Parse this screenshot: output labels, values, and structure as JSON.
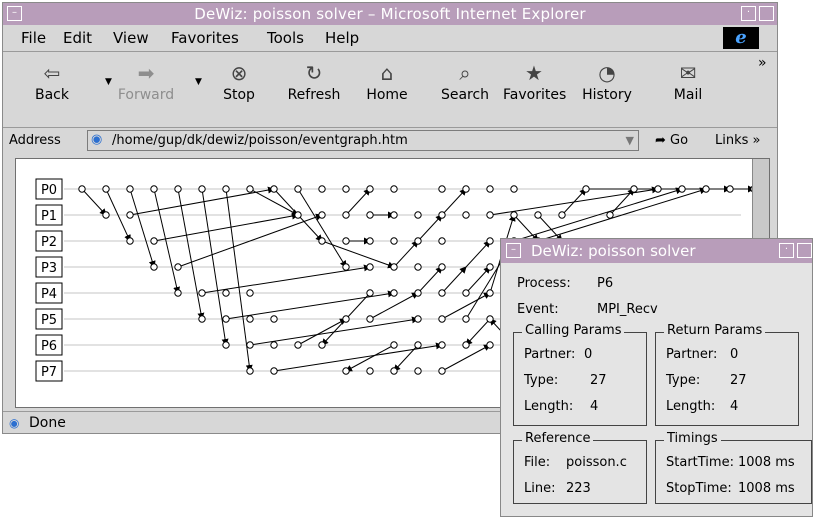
{
  "window": {
    "title": "DeWiz: poisson solver – Microsoft Internet Explorer"
  },
  "menu": {
    "items": [
      {
        "label": "File",
        "accel": "F"
      },
      {
        "label": "Edit",
        "accel": "E"
      },
      {
        "label": "View",
        "accel": "V"
      },
      {
        "label": "Favorites",
        "accel": "a"
      },
      {
        "label": "Tools",
        "accel": "T"
      },
      {
        "label": "Help",
        "accel": "H"
      }
    ],
    "logo": "e"
  },
  "toolbar": {
    "buttons": [
      {
        "label": "Back",
        "icon": "back-arrow-icon",
        "glyph": "⇦",
        "enabled": true
      },
      {
        "label": "Forward",
        "icon": "forward-arrow-icon",
        "glyph": "➡",
        "enabled": false
      },
      {
        "label": "Stop",
        "icon": "stop-icon",
        "glyph": "⊗",
        "enabled": true
      },
      {
        "label": "Refresh",
        "icon": "refresh-icon",
        "glyph": "↻",
        "enabled": true
      },
      {
        "label": "Home",
        "icon": "home-icon",
        "glyph": "⌂",
        "enabled": true
      },
      {
        "label": "Search",
        "icon": "search-icon",
        "glyph": "⌕",
        "enabled": true
      },
      {
        "label": "Favorites",
        "icon": "favorites-icon",
        "glyph": "★",
        "enabled": true
      },
      {
        "label": "History",
        "icon": "history-icon",
        "glyph": "◔",
        "enabled": true
      },
      {
        "label": "Mail",
        "icon": "mail-icon",
        "glyph": "✉",
        "enabled": true
      }
    ],
    "overflow": "»"
  },
  "address": {
    "label": "Address",
    "url": "/home/gup/dk/dewiz/poisson/eventgraph.htm",
    "go_label": "Go",
    "links_label": "Links »"
  },
  "event_graph": {
    "processes": [
      "P0",
      "P1",
      "P2",
      "P3",
      "P4",
      "P5",
      "P6",
      "P7"
    ],
    "events": [
      [
        0,
        0
      ],
      [
        1,
        0
      ],
      [
        2,
        0
      ],
      [
        3,
        0
      ],
      [
        4,
        0
      ],
      [
        5,
        0
      ],
      [
        6,
        0
      ],
      [
        7,
        0
      ],
      [
        8,
        0
      ],
      [
        9,
        0
      ],
      [
        10,
        0
      ],
      [
        11,
        0
      ],
      [
        12,
        0
      ],
      [
        13,
        0
      ],
      [
        15,
        0
      ],
      [
        16,
        0
      ],
      [
        17,
        0
      ],
      [
        18,
        0
      ],
      [
        21,
        0
      ],
      [
        23,
        0
      ],
      [
        24,
        0
      ],
      [
        25,
        0
      ],
      [
        26,
        0
      ],
      [
        27,
        0
      ],
      [
        28,
        0
      ],
      [
        1,
        1
      ],
      [
        2,
        1
      ],
      [
        9,
        1
      ],
      [
        10,
        1
      ],
      [
        11,
        1
      ],
      [
        12,
        1
      ],
      [
        13,
        1
      ],
      [
        14,
        1
      ],
      [
        15,
        1
      ],
      [
        16,
        1
      ],
      [
        17,
        1
      ],
      [
        18,
        1
      ],
      [
        19,
        1
      ],
      [
        20,
        1
      ],
      [
        22,
        1
      ],
      [
        2,
        2
      ],
      [
        3,
        2
      ],
      [
        10,
        2
      ],
      [
        11,
        2
      ],
      [
        12,
        2
      ],
      [
        13,
        2
      ],
      [
        14,
        2
      ],
      [
        15,
        2
      ],
      [
        17,
        2
      ],
      [
        18,
        2
      ],
      [
        19,
        2
      ],
      [
        3,
        3
      ],
      [
        4,
        3
      ],
      [
        11,
        3
      ],
      [
        12,
        3
      ],
      [
        13,
        3
      ],
      [
        14,
        3
      ],
      [
        15,
        3
      ],
      [
        17,
        3
      ],
      [
        4,
        4
      ],
      [
        5,
        4
      ],
      [
        6,
        4
      ],
      [
        7,
        4
      ],
      [
        12,
        4
      ],
      [
        13,
        4
      ],
      [
        14,
        4
      ],
      [
        15,
        4
      ],
      [
        16,
        4
      ],
      [
        17,
        4
      ],
      [
        5,
        5
      ],
      [
        6,
        5
      ],
      [
        7,
        5
      ],
      [
        8,
        5
      ],
      [
        11,
        5
      ],
      [
        12,
        5
      ],
      [
        14,
        5
      ],
      [
        15,
        5
      ],
      [
        16,
        5
      ],
      [
        17,
        5
      ],
      [
        6,
        6
      ],
      [
        7,
        6
      ],
      [
        8,
        6
      ],
      [
        9,
        6
      ],
      [
        10,
        6
      ],
      [
        13,
        6
      ],
      [
        14,
        6
      ],
      [
        15,
        6
      ],
      [
        16,
        6
      ],
      [
        17,
        6
      ],
      [
        18,
        6
      ],
      [
        7,
        7
      ],
      [
        8,
        7
      ],
      [
        11,
        7
      ],
      [
        12,
        7
      ],
      [
        13,
        7
      ],
      [
        14,
        7
      ],
      [
        15,
        7
      ]
    ],
    "messages": [
      [
        0,
        0,
        1,
        1
      ],
      [
        1,
        0,
        2,
        2
      ],
      [
        2,
        0,
        3,
        3
      ],
      [
        3,
        0,
        4,
        4
      ],
      [
        4,
        0,
        5,
        5
      ],
      [
        5,
        0,
        6,
        6
      ],
      [
        6,
        0,
        7,
        7
      ],
      [
        2,
        1,
        8,
        0
      ],
      [
        3,
        2,
        9,
        1
      ],
      [
        4,
        3,
        10,
        1
      ],
      [
        7,
        0,
        9,
        1
      ],
      [
        8,
        0,
        10,
        2
      ],
      [
        9,
        0,
        11,
        3
      ],
      [
        5,
        4,
        12,
        3
      ],
      [
        6,
        5,
        13,
        4
      ],
      [
        7,
        6,
        14,
        5
      ],
      [
        8,
        7,
        15,
        6
      ],
      [
        9,
        6,
        11,
        5
      ],
      [
        10,
        2,
        13,
        3
      ],
      [
        11,
        2,
        12,
        2
      ],
      [
        12,
        4,
        10,
        6
      ],
      [
        13,
        3,
        14,
        2
      ],
      [
        14,
        2,
        15,
        1
      ],
      [
        15,
        1,
        16,
        0
      ],
      [
        16,
        3,
        17,
        2
      ],
      [
        17,
        5,
        16,
        6
      ],
      [
        11,
        1,
        12,
        0
      ],
      [
        12,
        1,
        13,
        1
      ],
      [
        13,
        6,
        11,
        7
      ],
      [
        14,
        6,
        13,
        7
      ],
      [
        15,
        4,
        16,
        3
      ],
      [
        16,
        4,
        17,
        3
      ],
      [
        17,
        4,
        18,
        1
      ],
      [
        18,
        1,
        19,
        2
      ],
      [
        19,
        1,
        20,
        2
      ],
      [
        20,
        1,
        21,
        0
      ],
      [
        22,
        1,
        23,
        0
      ],
      [
        14,
        4,
        15,
        3
      ],
      [
        15,
        5,
        17,
        4
      ],
      [
        16,
        5,
        18,
        2
      ],
      [
        18,
        6,
        17,
        5
      ],
      [
        12,
        5,
        14,
        4
      ],
      [
        15,
        7,
        17,
        6
      ],
      [
        17,
        1,
        24,
        0
      ],
      [
        18,
        2,
        25,
        0
      ],
      [
        19,
        2,
        26,
        0
      ],
      [
        21,
        0,
        27,
        0
      ],
      [
        23,
        0,
        28,
        0
      ]
    ]
  },
  "status": {
    "text": "Done"
  },
  "popup": {
    "title": "DeWiz: poisson solver",
    "process_label": "Process:",
    "process_value": "P6",
    "event_label": "Event:",
    "event_value": "MPI_Recv",
    "calling": {
      "title": "Calling Params",
      "partner_label": "Partner:",
      "partner_value": "0",
      "type_label": "Type:",
      "type_value": "27",
      "length_label": "Length:",
      "length_value": "4"
    },
    "return": {
      "title": "Return Params",
      "partner_label": "Partner:",
      "partner_value": "0",
      "type_label": "Type:",
      "type_value": "27",
      "length_label": "Length:",
      "length_value": "4"
    },
    "reference": {
      "title": "Reference",
      "file_label": "File:",
      "file_value": "poisson.c",
      "line_label": "Line:",
      "line_value": "223"
    },
    "timings": {
      "title": "Timings",
      "start_label": "StartTime:",
      "start_value": "1008 ms",
      "stop_label": "StopTime:",
      "stop_value": "1008 ms"
    }
  }
}
